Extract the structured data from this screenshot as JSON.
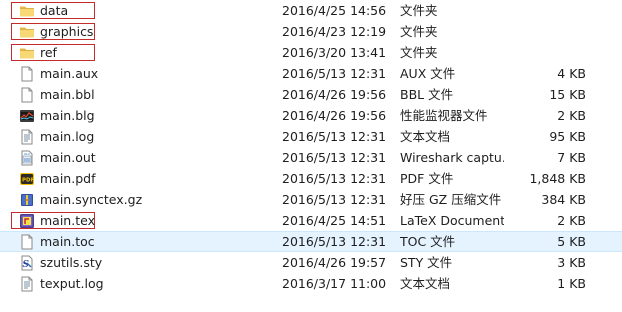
{
  "files": [
    {
      "name": "data",
      "date": "2016/4/25 14:56",
      "type": "文件夹",
      "size": "",
      "icon": "folder-icon",
      "highlighted": true
    },
    {
      "name": "graphics",
      "date": "2016/4/23 12:19",
      "type": "文件夹",
      "size": "",
      "icon": "folder-icon",
      "highlighted": true
    },
    {
      "name": "ref",
      "date": "2016/3/20 13:41",
      "type": "文件夹",
      "size": "",
      "icon": "folder-icon",
      "highlighted": true
    },
    {
      "name": "main.aux",
      "date": "2016/5/13 12:31",
      "type": "AUX 文件",
      "size": "4 KB",
      "icon": "blank-file-icon"
    },
    {
      "name": "main.bbl",
      "date": "2016/4/26 19:56",
      "type": "BBL 文件",
      "size": "15 KB",
      "icon": "blank-file-icon"
    },
    {
      "name": "main.blg",
      "date": "2016/4/26 19:56",
      "type": "性能监视器文件",
      "size": "2 KB",
      "icon": "perfmon-file-icon"
    },
    {
      "name": "main.log",
      "date": "2016/5/13 12:31",
      "type": "文本文档",
      "size": "95 KB",
      "icon": "text-file-icon"
    },
    {
      "name": "main.out",
      "date": "2016/5/13 12:31",
      "type": "Wireshark captu...",
      "size": "7 KB",
      "icon": "wireshark-file-icon"
    },
    {
      "name": "main.pdf",
      "date": "2016/5/13 12:31",
      "type": "PDF 文件",
      "size": "1,848 KB",
      "icon": "pdf-file-icon"
    },
    {
      "name": "main.synctex.gz",
      "date": "2016/5/13 12:31",
      "type": "好压 GZ 压缩文件",
      "size": "384 KB",
      "icon": "archive-file-icon"
    },
    {
      "name": "main.tex",
      "date": "2016/4/25 14:51",
      "type": "LaTeX Document",
      "size": "2 KB",
      "icon": "latex-file-icon",
      "highlighted": true
    },
    {
      "name": "main.toc",
      "date": "2016/5/13 12:31",
      "type": "TOC 文件",
      "size": "5 KB",
      "icon": "blank-file-icon",
      "selected": true
    },
    {
      "name": "szutils.sty",
      "date": "2016/4/26 19:57",
      "type": "STY 文件",
      "size": "3 KB",
      "icon": "sty-file-icon"
    },
    {
      "name": "texput.log",
      "date": "2016/3/17 11:00",
      "type": "文本文档",
      "size": "1 KB",
      "icon": "text-file-icon"
    }
  ]
}
